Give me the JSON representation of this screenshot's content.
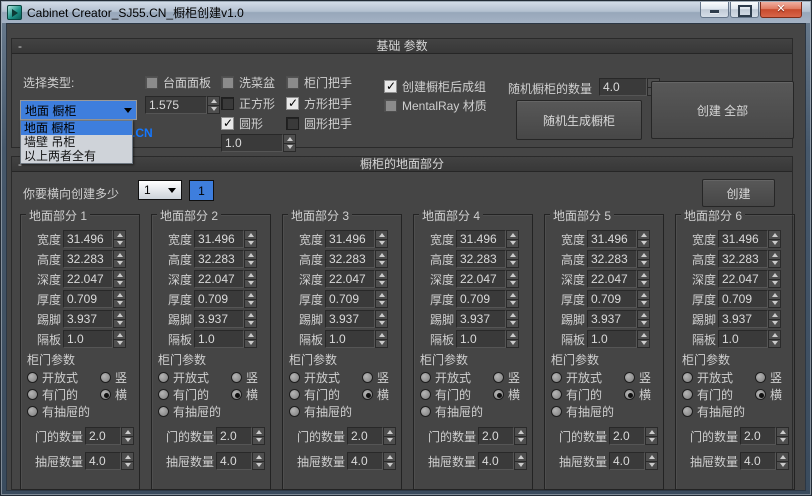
{
  "window": {
    "title": "Cabinet Creator_SJ55.CN_橱柜创建v1.0"
  },
  "colors": {
    "accent_blue": "#3e7edd",
    "close_red": "#c74a2d",
    "watermark_blue": "#1477ff",
    "panel_gray": "#454545"
  },
  "basic": {
    "header": "基础 参数",
    "collapse_glyph": "-",
    "type_label": "选择类型:",
    "type_combo": {
      "value": "地面 橱柜",
      "options": [
        {
          "label": "地面 橱柜",
          "selected": true
        },
        {
          "label": "墙壁 吊柜",
          "selected": false
        },
        {
          "label": "以上两者全有",
          "selected": false
        }
      ]
    },
    "watermark": ".CN",
    "countertop": {
      "label": "台面面板",
      "state": "grayed"
    },
    "countertop_value": "1.575",
    "sink": {
      "label": "洗菜盆",
      "state": "grayed"
    },
    "square": {
      "label": "正方形",
      "state": "unchecked"
    },
    "round": {
      "label": "圆形",
      "state": "checked"
    },
    "round_value": "1.0",
    "handle": {
      "label": "柜门把手",
      "state": "grayed"
    },
    "square_handle": {
      "label": "方形把手",
      "state": "checked"
    },
    "round_handle": {
      "label": "圆形把手",
      "state": "unchecked"
    },
    "group_after": {
      "label": "创建橱柜后成组",
      "state": "checked"
    },
    "mentalray": {
      "label": "MentalRay 材质",
      "state": "grayed"
    },
    "random_count_label": "随机橱柜的数量",
    "random_count_value": "4.0",
    "random_generate_button": "随机生成橱柜",
    "create_all_button": "创建 全部"
  },
  "floor": {
    "header": "橱柜的地面部分",
    "collapse_glyph": "-",
    "count_label": "你要横向创建多少",
    "count_combo_value": "1",
    "count_button": "1",
    "create_button": "创建",
    "group_titles": [
      "地面部分 1",
      "地面部分 2",
      "地面部分 3",
      "地面部分 4",
      "地面部分 5",
      "地面部分 6"
    ],
    "dim_fields": [
      {
        "label": "宽度",
        "value": "31.496"
      },
      {
        "label": "高度",
        "value": "32.283"
      },
      {
        "label": "深度",
        "value": "22.047"
      },
      {
        "label": "厚度",
        "value": "0.709"
      },
      {
        "label": "踢脚",
        "value": "3.937"
      },
      {
        "label": "隔板",
        "value": "1.0"
      }
    ],
    "door_params_label": "柜门参数",
    "door_type_radios": [
      {
        "label": "开放式",
        "checked": false
      },
      {
        "label": "有门的",
        "checked": false
      },
      {
        "label": "有抽屉的",
        "checked": false
      }
    ],
    "orient_radios": [
      {
        "label": "竖",
        "checked": false
      },
      {
        "label": "横",
        "checked": true
      }
    ],
    "door_count": {
      "label": "门的数量",
      "value": "2.0"
    },
    "drawer_count": {
      "label": "抽屉数量",
      "value": "4.0"
    }
  }
}
